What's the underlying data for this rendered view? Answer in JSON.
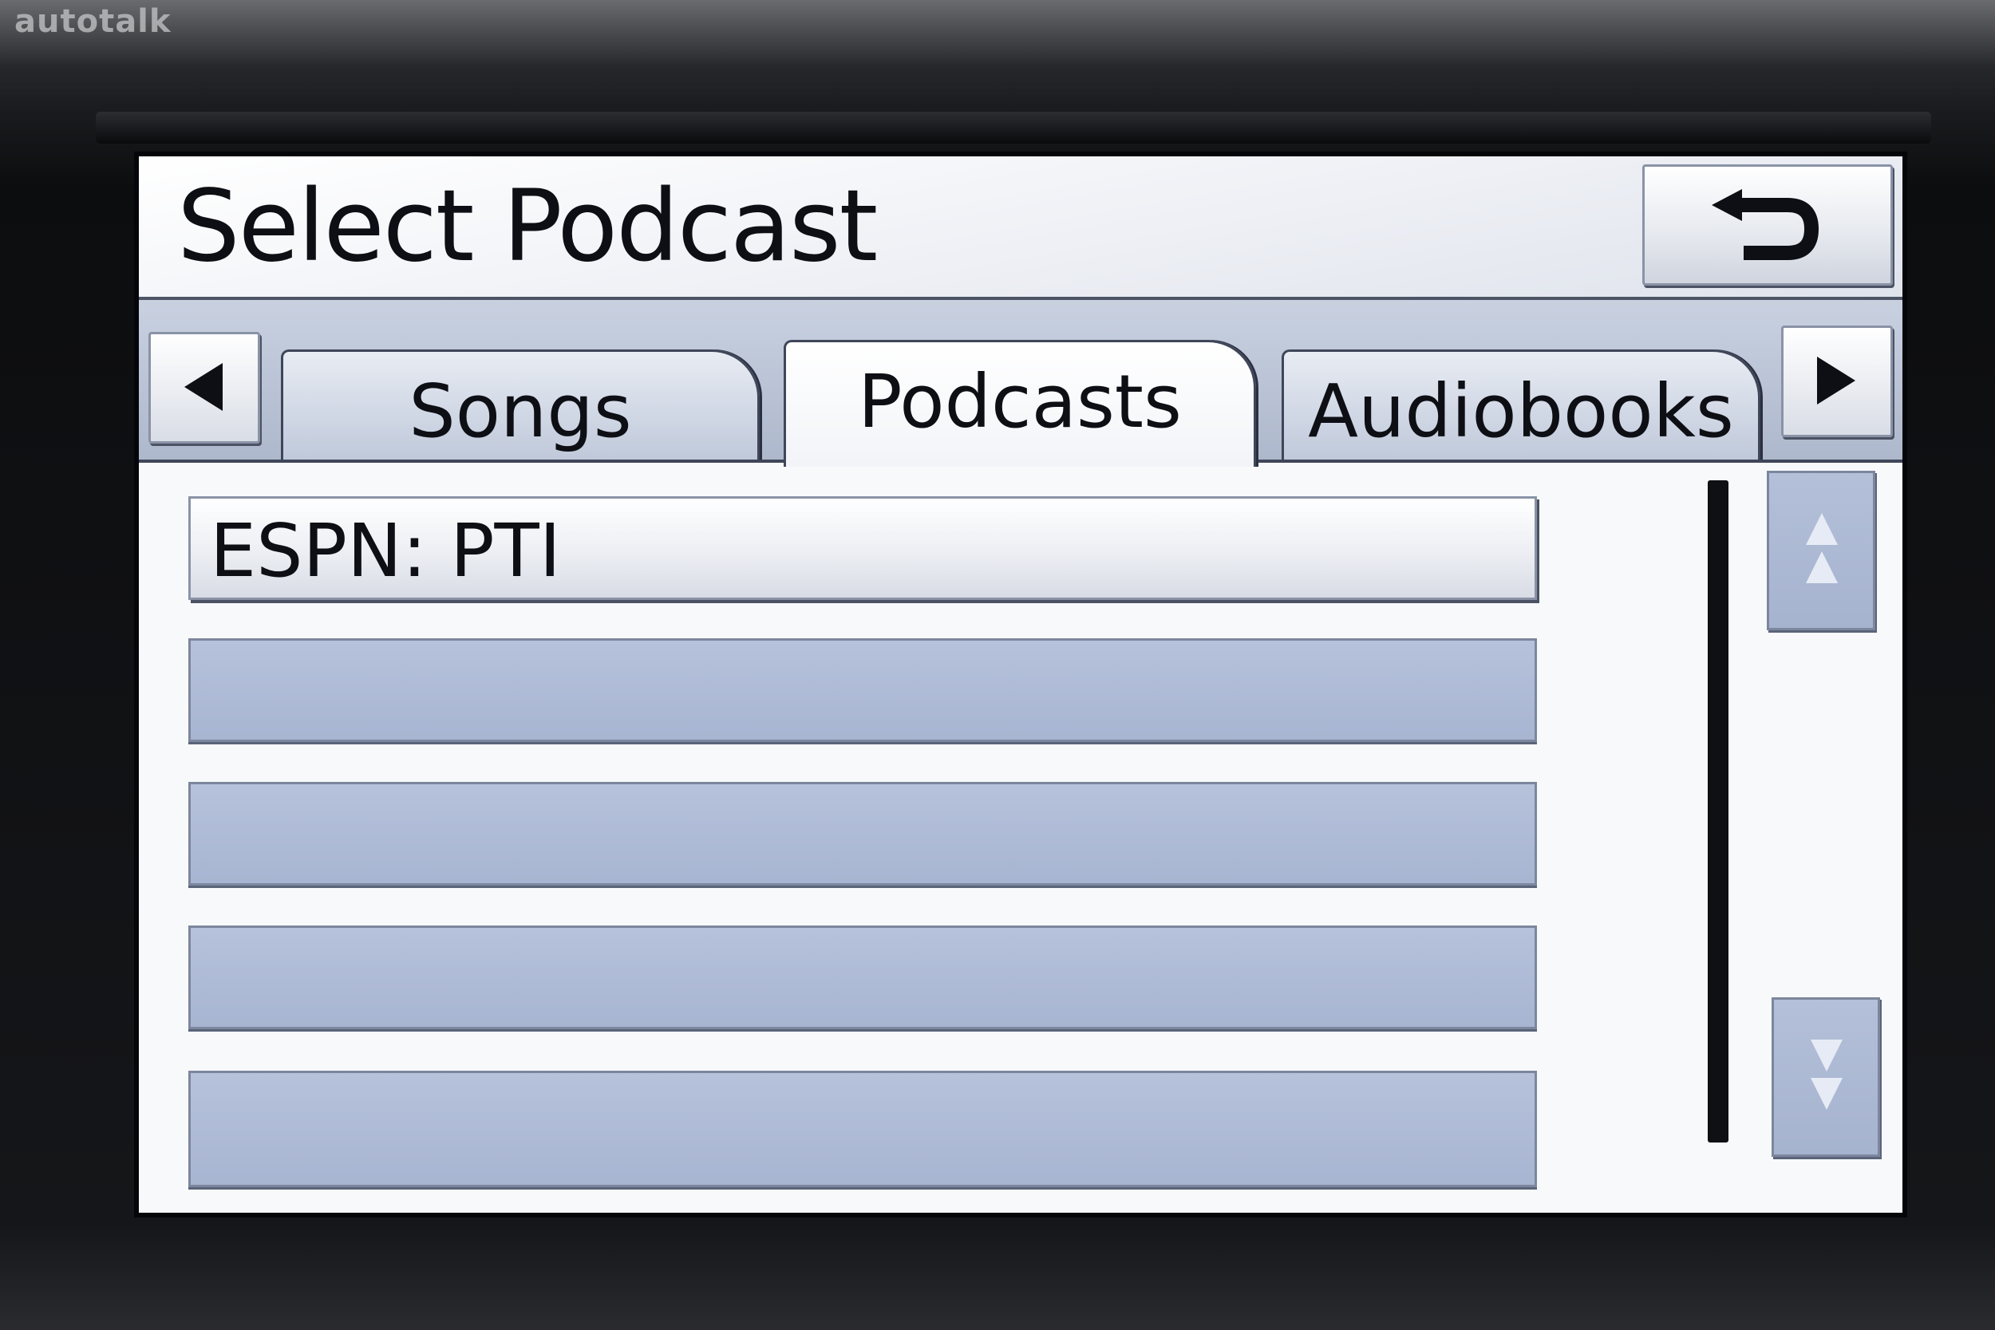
{
  "watermark": "autotalk",
  "header": {
    "title": "Select Podcast",
    "back_icon": "return-arrow-icon"
  },
  "tabs": [
    {
      "label": "Songs",
      "active": false
    },
    {
      "label": "Podcasts",
      "active": true
    },
    {
      "label": "Audiobooks",
      "active": false
    }
  ],
  "tab_nav": {
    "prev_icon": "triangle-left-icon",
    "next_icon": "triangle-right-icon"
  },
  "list": {
    "items": [
      {
        "label": "ESPN: PTI"
      },
      {
        "label": ""
      },
      {
        "label": ""
      },
      {
        "label": ""
      },
      {
        "label": ""
      }
    ]
  },
  "scroll": {
    "up_icon": "page-up-icon",
    "down_icon": "page-down-icon"
  },
  "colors": {
    "screen_bg": "#f4f5f8",
    "row_empty": "#aebbd5",
    "text": "#0d0f14",
    "bezel": "#111214"
  }
}
